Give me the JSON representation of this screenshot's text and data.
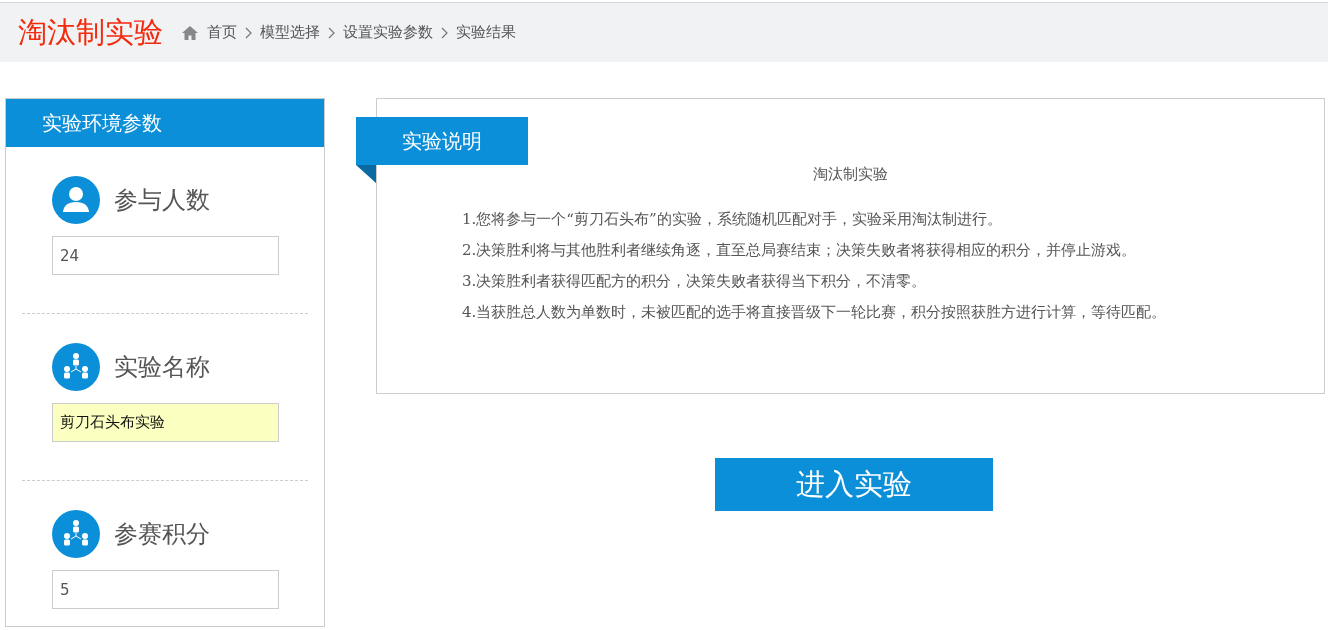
{
  "header": {
    "title": "淘汰制实验",
    "breadcrumb": [
      "首页",
      "模型选择",
      "设置实验参数",
      "实验结果"
    ]
  },
  "sidebar": {
    "title": "实验环境参数",
    "params": [
      {
        "kind": "person",
        "label": "参与人数",
        "value": "24",
        "autofilled": false
      },
      {
        "kind": "group",
        "label": "实验名称",
        "value": "剪刀石头布实验",
        "autofilled": true
      },
      {
        "kind": "group",
        "label": "参赛积分",
        "value": "5",
        "autofilled": false
      }
    ]
  },
  "description": {
    "tab": "实验说明",
    "heading": "淘汰制实验",
    "items": [
      "1.您将参与一个“剪刀石头布”的实验，系统随机匹配对手，实验采用淘汰制进行。",
      "2.决策胜利将与其他胜利者继续角逐，直至总局赛结束；决策失败者将获得相应的积分，并停止游戏。",
      "3.决策胜利者获得匹配方的积分，决策失败者获得当下积分，不清零。",
      "4.当获胜总人数为单数时，未被匹配的选手将直接晋级下一轮比赛，积分按照获胜方进行计算，等待匹配。"
    ]
  },
  "start_button": "进入实验"
}
